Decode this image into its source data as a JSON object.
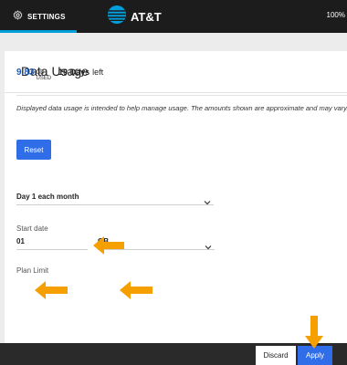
{
  "topbar": {
    "settings_label": "SETTINGS",
    "brand": "AT&T",
    "battery": "100%"
  },
  "card": {
    "title": "Data Usage",
    "usage_value": "9.83",
    "usage_unit_top": "GB",
    "usage_unit_bottom": "USED",
    "days_number": "19 Days",
    "days_text": "left",
    "disclaimer": "Displayed data usage is intended to help manage usage. The amounts shown are approximate and may vary.",
    "reset_label": "Reset",
    "start_date_label": "Start date",
    "start_date_value": "Day 1 each month",
    "plan_limit_label": "Plan Limit",
    "plan_limit_value": "01",
    "plan_unit_value": "GB"
  },
  "bottombar": {
    "discard_label": "Discard",
    "apply_label": "Apply"
  },
  "colors": {
    "accent": "#2f6ee8",
    "usage_blue": "#1f5bbd",
    "arrow": "#f5a000",
    "topbar": "#1c1c1c",
    "tab_underline": "#009fdb"
  },
  "icons": [
    "gear-icon",
    "att-globe-logo",
    "chevron-down-icon",
    "annotation-arrow"
  ]
}
